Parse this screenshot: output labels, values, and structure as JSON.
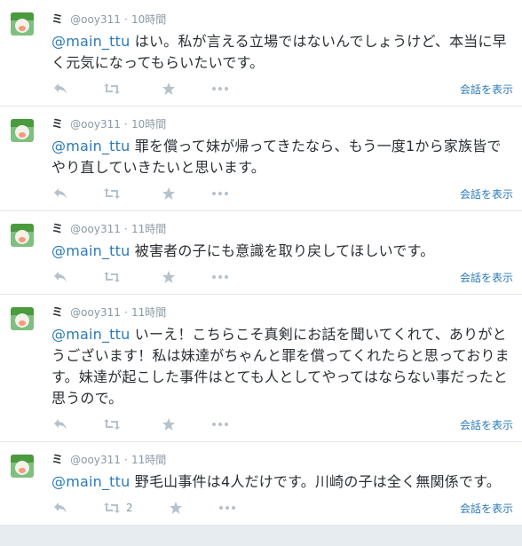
{
  "tweets": [
    {
      "name": "ミ",
      "handle": "@ooy311",
      "sep": "·",
      "time": "10時間",
      "mention": "@main_ttu",
      "text": " はい。私が言える立場ではないんでしょうけど、本当に早く元気になってもらいたいです。",
      "retweet_count": "",
      "conversation_label": "会話を表示"
    },
    {
      "name": "ミ",
      "handle": "@ooy311",
      "sep": "·",
      "time": "10時間",
      "mention": "@main_ttu",
      "text": " 罪を償って妹が帰ってきたなら、もう一度1から家族皆でやり直していきたいと思います。",
      "retweet_count": "",
      "conversation_label": "会話を表示"
    },
    {
      "name": "ミ",
      "handle": "@ooy311",
      "sep": "·",
      "time": "11時間",
      "mention": "@main_ttu",
      "text": " 被害者の子にも意識を取り戻してほしいです。",
      "retweet_count": "",
      "conversation_label": "会話を表示"
    },
    {
      "name": "ミ",
      "handle": "@ooy311",
      "sep": "·",
      "time": "11時間",
      "mention": "@main_ttu",
      "text": " いーえ！こちらこそ真剣にお話を聞いてくれて、ありがとうございます！私は妹達がちゃんと罪を償ってくれたらと思っております。妹達が起こした事件はとても人としてやってはならない事だったと思うので。",
      "retweet_count": "",
      "conversation_label": "会話を表示"
    },
    {
      "name": "ミ",
      "handle": "@ooy311",
      "sep": "·",
      "time": "11時間",
      "mention": "@main_ttu",
      "text": " 野毛山事件は4人だけです。川崎の子は全く無関係です。",
      "retweet_count": "2",
      "conversation_label": "会話を表示"
    }
  ],
  "icons": {
    "reply": "reply-icon",
    "retweet": "retweet-icon",
    "favorite": "star-icon",
    "more": "more-icon"
  }
}
